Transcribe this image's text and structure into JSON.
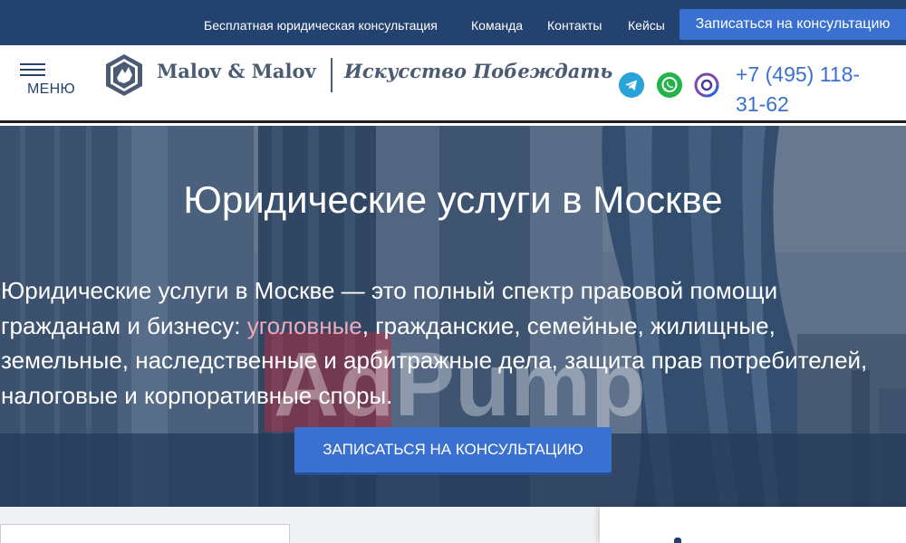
{
  "topbar": {
    "links": [
      "Бесплатная юридическая консультация",
      "Команда",
      "Контакты",
      "Кейсы"
    ],
    "cta_label": "Записаться на консультацию"
  },
  "header": {
    "menu_label": "МЕНЮ",
    "brand_name": "Malov & Malov",
    "slogan": "Искусство Побеждать",
    "phone": "+7 (495) 118-31-62",
    "socials": [
      "telegram-icon",
      "whatsapp-icon",
      "viber-icon"
    ]
  },
  "hero": {
    "title": "Юридические услуги в Москве",
    "text_before": "Юридические услуги в Москве — это полный спектр правовой помощи гражданам и бизнесу: ",
    "text_link": "уголовные",
    "text_after": ", гражданские, семейные, жилищные, земельные, наследственные и арбитражные дела, защита прав потребителей, налоговые и корпоративные споры.",
    "cta_label": "ЗАПИСАТЬСЯ НА КОНСУЛЬТАЦИЮ",
    "watermark": "AdPump"
  },
  "colors": {
    "topbar": "#23426f",
    "accent": "#3a70cf",
    "brand_text": "#4a5b73",
    "link_highlight": "#f0a7b8"
  }
}
